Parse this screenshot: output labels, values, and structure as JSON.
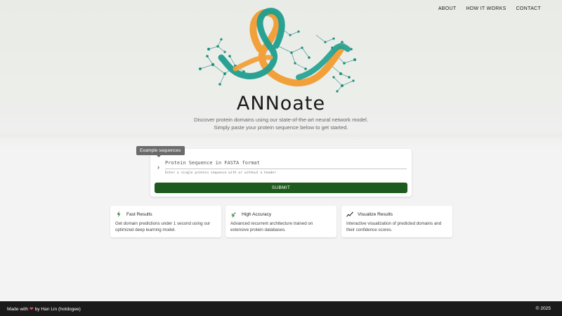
{
  "nav": {
    "about": "ABOUT",
    "how_it_works": "HOW IT WORKS",
    "contact": "CONTACT"
  },
  "hero": {
    "brand": "ANNoate",
    "tagline_line1": "Discover protein domains using our state-of-the-art neural network model.",
    "tagline_line2": "Simply paste your protein sequence below to get started."
  },
  "form": {
    "tooltip": "Example sequences",
    "caret_icon": "chevron-right-icon",
    "input_placeholder": "Protein Sequence in FASTA format",
    "input_value": "",
    "helper": "Enter a single protein sequence with or without a header",
    "submit_label": "SUBMIT",
    "submit_color": "#1e5a1e"
  },
  "features": [
    {
      "icon": "lightning-bolt-icon",
      "title": "Fast Results",
      "description": "Get domain predictions under 1 second using our optimized deep learning model."
    },
    {
      "icon": "satellite-dish-icon",
      "title": "High Accuracy",
      "description": "Advanced recurrent architecture trained on extensive protein databases."
    },
    {
      "icon": "trend-chart-icon",
      "title": "Visualize Results",
      "description": "Interactive visualization of predicted domains and their confidence scores."
    }
  ],
  "footer": {
    "made_with": "Made with",
    "heart_icon": "heart-icon",
    "by": "by Han Lin (hotdogee)",
    "copyright": "© 2025"
  },
  "colors": {
    "accent": "#1e5a1e",
    "ribbon_orange": "#f2a03a",
    "ribbon_teal": "#1f9e8f",
    "node_teal": "#1b8f80",
    "footer_bg": "#1a1a1a"
  }
}
